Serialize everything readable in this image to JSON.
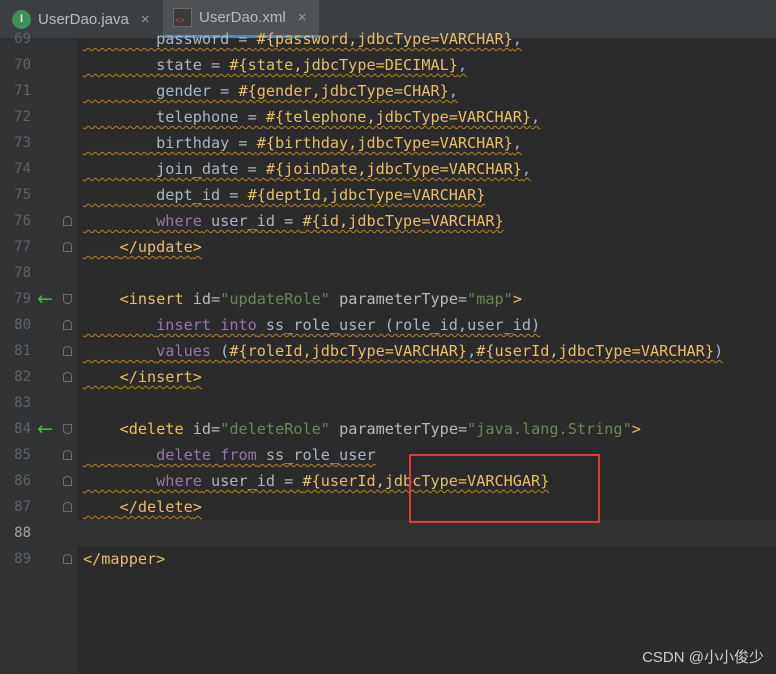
{
  "tabs": [
    {
      "label": "UserDao.java",
      "icon": "java-interface-icon",
      "icon_letter": "I",
      "active": false,
      "close": "×"
    },
    {
      "label": "UserDao.xml",
      "icon": "xml-file-icon",
      "icon_letter": "<>",
      "active": true,
      "close": "×"
    }
  ],
  "gutter_icons": {
    "implementation_marker": "←"
  },
  "lines": [
    {
      "num": "69",
      "text": "        password = #{password,jdbcType=VARCHAR},"
    },
    {
      "num": "70",
      "text": "        state = #{state,jdbcType=DECIMAL},"
    },
    {
      "num": "71",
      "text": "        gender = #{gender,jdbcType=CHAR},"
    },
    {
      "num": "72",
      "text": "        telephone = #{telephone,jdbcType=VARCHAR},"
    },
    {
      "num": "73",
      "text": "        birthday = #{birthday,jdbcType=VARCHAR},"
    },
    {
      "num": "74",
      "text": "        join_date = #{joinDate,jdbcType=VARCHAR},"
    },
    {
      "num": "75",
      "text": "        dept_id = #{deptId,jdbcType=VARCHAR}"
    },
    {
      "num": "76",
      "text": "        where user_id = #{id,jdbcType=VARCHAR}"
    },
    {
      "num": "77",
      "text": "    </update>"
    },
    {
      "num": "78",
      "text": ""
    },
    {
      "num": "79",
      "text": "    <insert id=\"updateRole\" parameterType=\"map\">"
    },
    {
      "num": "80",
      "text": "        insert into ss_role_user (role_id,user_id)"
    },
    {
      "num": "81",
      "text": "        values (#{roleId,jdbcType=VARCHAR},#{userId,jdbcType=VARCHAR})"
    },
    {
      "num": "82",
      "text": "    </insert>"
    },
    {
      "num": "83",
      "text": ""
    },
    {
      "num": "84",
      "text": "    <delete id=\"deleteRole\" parameterType=\"java.lang.String\">"
    },
    {
      "num": "85",
      "text": "        delete from ss_role_user"
    },
    {
      "num": "86",
      "text": "        where user_id = #{userId,jdbcType=VARCHGAR}"
    },
    {
      "num": "87",
      "text": "    </delete>"
    },
    {
      "num": "88",
      "text": ""
    },
    {
      "num": "89",
      "text": "</mapper>"
    }
  ],
  "current_line": "88",
  "highlight_box_color": "#e53935",
  "watermark": "CSDN @小小俊少",
  "colors": {
    "tag": "#e8bf6a",
    "attr": "#bababa",
    "string": "#6a8759",
    "keyword": "#cc7832",
    "text": "#a9b7c6",
    "param": "#e8bf6a",
    "sql_keyword": "#9876aa"
  }
}
